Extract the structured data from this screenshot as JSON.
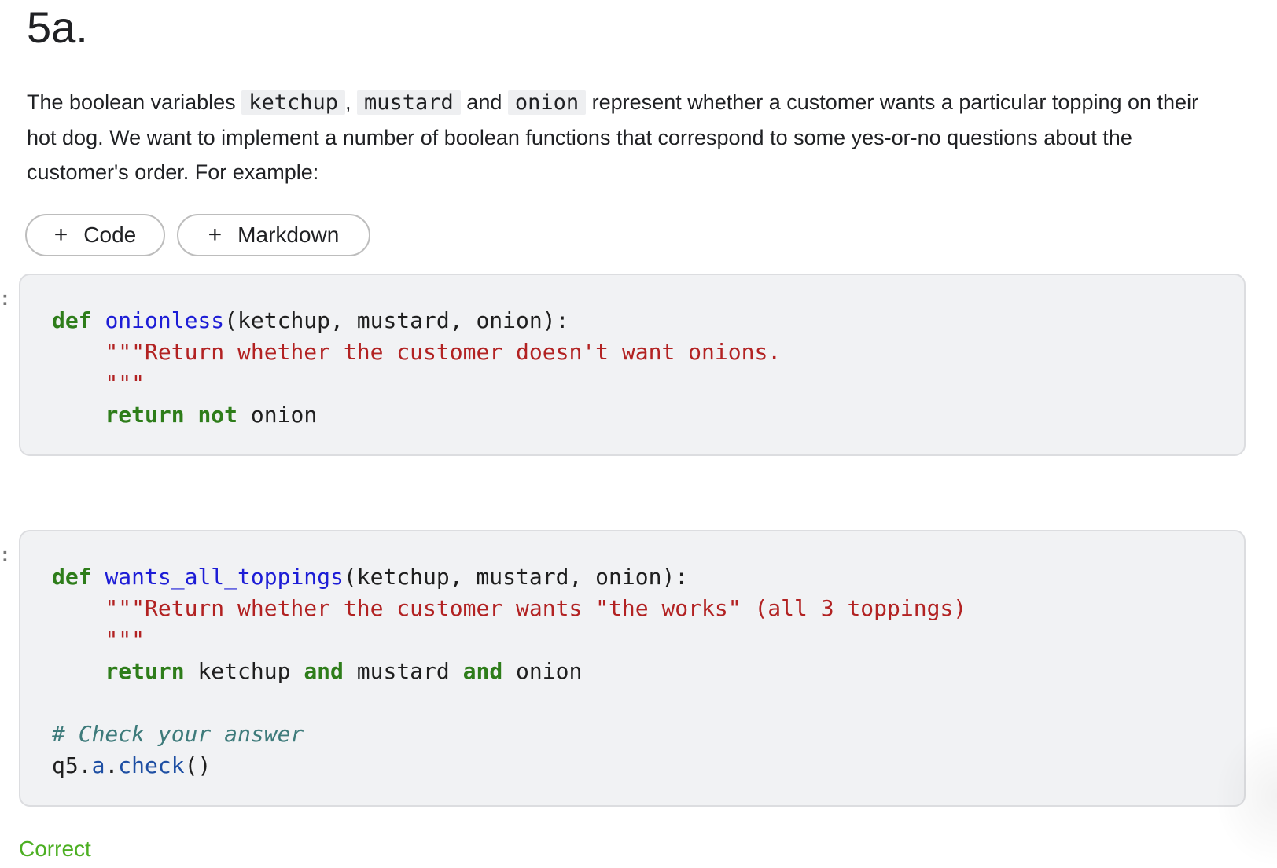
{
  "heading": "5a.",
  "intro": {
    "p1": "The boolean variables ",
    "var1": "ketchup",
    "sep1": ", ",
    "var2": "mustard",
    "sep2": " and ",
    "var3": "onion",
    "p2": " represent whether a customer wants a particular topping on their hot dog. We want to implement a number of boolean functions that correspond to some yes-or-no questions about the customer's order. For example:"
  },
  "toolbar": {
    "code_plus": "+",
    "code_label": "Code",
    "md_plus": "+",
    "md_label": "Markdown"
  },
  "cell_marker": ":",
  "cell1": {
    "def": "def",
    "fn_name": "onionless",
    "params": "(ketchup, mustard, onion):",
    "doc_line1": "    \"\"\"Return whether the customer doesn't want onions.",
    "doc_line2": "    \"\"\"",
    "ret_indent": "    ",
    "ret_kw": "return",
    "not_kw": "not",
    "ret_val": " onion"
  },
  "cell2": {
    "def": "def",
    "fn_name": "wants_all_toppings",
    "params": "(ketchup, mustard, onion):",
    "doc_line1": "    \"\"\"Return whether the customer wants \"the works\" (all 3 toppings)",
    "doc_line2": "    \"\"\"",
    "ret_indent": "    ",
    "ret_kw": "return",
    "v1": " ketchup ",
    "and1": "and",
    "v2": " mustard ",
    "and2": "and",
    "v3": " onion",
    "comment": "# Check your answer",
    "call_obj": "q5.",
    "call_attr": "a",
    "call_dot": ".",
    "call_fn": "check",
    "call_parens": "()"
  },
  "result": "Correct"
}
